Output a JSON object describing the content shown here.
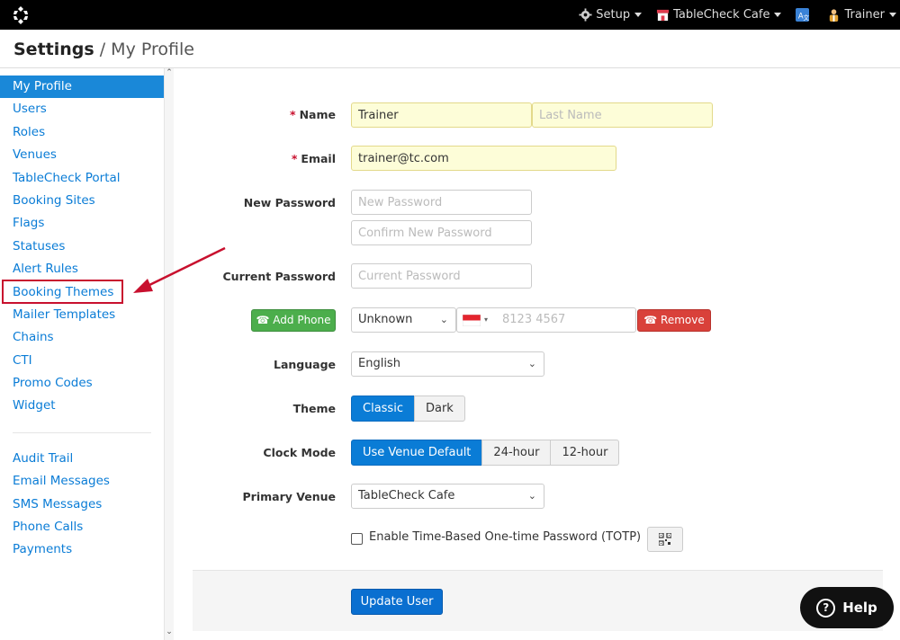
{
  "topbar": {
    "logo_icon": "tablecheck-logo-icon",
    "setup_label": "Setup",
    "venue_label": "TableCheck Cafe",
    "translate_icon": "translate-icon",
    "user_label": "Trainer"
  },
  "titlebar": {
    "section": "Settings",
    "separator": " / ",
    "page": "My Profile"
  },
  "sidebar": {
    "items": [
      {
        "label": "My Profile",
        "active": true
      },
      {
        "label": "Users"
      },
      {
        "label": "Roles"
      },
      {
        "label": "Venues"
      },
      {
        "label": "TableCheck Portal"
      },
      {
        "label": "Booking Sites"
      },
      {
        "label": "Flags"
      },
      {
        "label": "Statuses"
      },
      {
        "label": "Alert Rules"
      },
      {
        "label": "Booking Themes"
      },
      {
        "label": "Mailer Templates"
      },
      {
        "label": "Chains"
      },
      {
        "label": "CTI"
      },
      {
        "label": "Promo Codes"
      },
      {
        "label": "Widget"
      }
    ],
    "items2": [
      {
        "label": "Audit Trail"
      },
      {
        "label": "Email Messages"
      },
      {
        "label": "SMS Messages"
      },
      {
        "label": "Phone Calls"
      },
      {
        "label": "Payments"
      }
    ]
  },
  "form": {
    "name_label": "Name",
    "first_name_value": "Trainer",
    "last_name_placeholder": "Last Name",
    "email_label": "Email",
    "email_value": "trainer@tc.com",
    "new_password_label": "New Password",
    "new_password_placeholder": "New Password",
    "confirm_password_placeholder": "Confirm New Password",
    "current_password_label": "Current Password",
    "current_password_placeholder": "Current Password",
    "add_phone_label": "Add Phone",
    "phone_type_value": "Unknown",
    "phone_placeholder": "8123 4567",
    "remove_label": "Remove",
    "language_label": "Language",
    "language_value": "English",
    "theme_label": "Theme",
    "theme_options": [
      "Classic",
      "Dark"
    ],
    "theme_selected": "Classic",
    "clock_label": "Clock Mode",
    "clock_options": [
      "Use Venue Default",
      "24-hour",
      "12-hour"
    ],
    "clock_selected": "Use Venue Default",
    "primary_venue_label": "Primary Venue",
    "primary_venue_value": "TableCheck Cafe",
    "totp_label": "Enable Time-Based One-time Password (TOTP)",
    "totp_checked": false,
    "update_label": "Update User"
  },
  "help": {
    "label": "Help"
  },
  "colors": {
    "accent": "#1a88d8",
    "highlight": "#c8102e",
    "green": "#4cae4c",
    "red": "#d9413a"
  }
}
